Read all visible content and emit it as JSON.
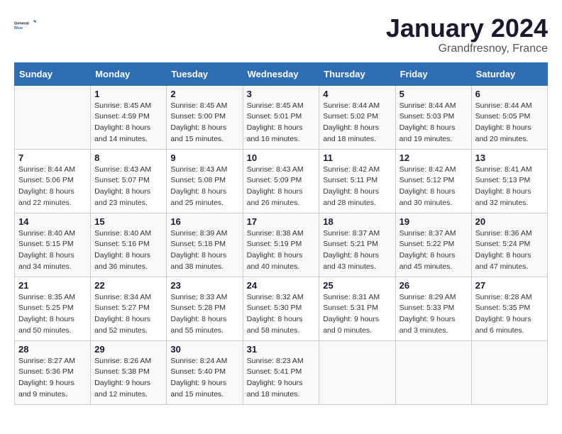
{
  "logo": {
    "line1": "General",
    "line2": "Blue"
  },
  "title": "January 2024",
  "subtitle": "Grandfresnoy, France",
  "days_of_week": [
    "Sunday",
    "Monday",
    "Tuesday",
    "Wednesday",
    "Thursday",
    "Friday",
    "Saturday"
  ],
  "weeks": [
    [
      {
        "day": "",
        "sunrise": "",
        "sunset": "",
        "daylight": ""
      },
      {
        "day": "1",
        "sunrise": "Sunrise: 8:45 AM",
        "sunset": "Sunset: 4:59 PM",
        "daylight": "Daylight: 8 hours and 14 minutes."
      },
      {
        "day": "2",
        "sunrise": "Sunrise: 8:45 AM",
        "sunset": "Sunset: 5:00 PM",
        "daylight": "Daylight: 8 hours and 15 minutes."
      },
      {
        "day": "3",
        "sunrise": "Sunrise: 8:45 AM",
        "sunset": "Sunset: 5:01 PM",
        "daylight": "Daylight: 8 hours and 16 minutes."
      },
      {
        "day": "4",
        "sunrise": "Sunrise: 8:44 AM",
        "sunset": "Sunset: 5:02 PM",
        "daylight": "Daylight: 8 hours and 18 minutes."
      },
      {
        "day": "5",
        "sunrise": "Sunrise: 8:44 AM",
        "sunset": "Sunset: 5:03 PM",
        "daylight": "Daylight: 8 hours and 19 minutes."
      },
      {
        "day": "6",
        "sunrise": "Sunrise: 8:44 AM",
        "sunset": "Sunset: 5:05 PM",
        "daylight": "Daylight: 8 hours and 20 minutes."
      }
    ],
    [
      {
        "day": "7",
        "sunrise": "Sunrise: 8:44 AM",
        "sunset": "Sunset: 5:06 PM",
        "daylight": "Daylight: 8 hours and 22 minutes."
      },
      {
        "day": "8",
        "sunrise": "Sunrise: 8:43 AM",
        "sunset": "Sunset: 5:07 PM",
        "daylight": "Daylight: 8 hours and 23 minutes."
      },
      {
        "day": "9",
        "sunrise": "Sunrise: 8:43 AM",
        "sunset": "Sunset: 5:08 PM",
        "daylight": "Daylight: 8 hours and 25 minutes."
      },
      {
        "day": "10",
        "sunrise": "Sunrise: 8:43 AM",
        "sunset": "Sunset: 5:09 PM",
        "daylight": "Daylight: 8 hours and 26 minutes."
      },
      {
        "day": "11",
        "sunrise": "Sunrise: 8:42 AM",
        "sunset": "Sunset: 5:11 PM",
        "daylight": "Daylight: 8 hours and 28 minutes."
      },
      {
        "day": "12",
        "sunrise": "Sunrise: 8:42 AM",
        "sunset": "Sunset: 5:12 PM",
        "daylight": "Daylight: 8 hours and 30 minutes."
      },
      {
        "day": "13",
        "sunrise": "Sunrise: 8:41 AM",
        "sunset": "Sunset: 5:13 PM",
        "daylight": "Daylight: 8 hours and 32 minutes."
      }
    ],
    [
      {
        "day": "14",
        "sunrise": "Sunrise: 8:40 AM",
        "sunset": "Sunset: 5:15 PM",
        "daylight": "Daylight: 8 hours and 34 minutes."
      },
      {
        "day": "15",
        "sunrise": "Sunrise: 8:40 AM",
        "sunset": "Sunset: 5:16 PM",
        "daylight": "Daylight: 8 hours and 36 minutes."
      },
      {
        "day": "16",
        "sunrise": "Sunrise: 8:39 AM",
        "sunset": "Sunset: 5:18 PM",
        "daylight": "Daylight: 8 hours and 38 minutes."
      },
      {
        "day": "17",
        "sunrise": "Sunrise: 8:38 AM",
        "sunset": "Sunset: 5:19 PM",
        "daylight": "Daylight: 8 hours and 40 minutes."
      },
      {
        "day": "18",
        "sunrise": "Sunrise: 8:37 AM",
        "sunset": "Sunset: 5:21 PM",
        "daylight": "Daylight: 8 hours and 43 minutes."
      },
      {
        "day": "19",
        "sunrise": "Sunrise: 8:37 AM",
        "sunset": "Sunset: 5:22 PM",
        "daylight": "Daylight: 8 hours and 45 minutes."
      },
      {
        "day": "20",
        "sunrise": "Sunrise: 8:36 AM",
        "sunset": "Sunset: 5:24 PM",
        "daylight": "Daylight: 8 hours and 47 minutes."
      }
    ],
    [
      {
        "day": "21",
        "sunrise": "Sunrise: 8:35 AM",
        "sunset": "Sunset: 5:25 PM",
        "daylight": "Daylight: 8 hours and 50 minutes."
      },
      {
        "day": "22",
        "sunrise": "Sunrise: 8:34 AM",
        "sunset": "Sunset: 5:27 PM",
        "daylight": "Daylight: 8 hours and 52 minutes."
      },
      {
        "day": "23",
        "sunrise": "Sunrise: 8:33 AM",
        "sunset": "Sunset: 5:28 PM",
        "daylight": "Daylight: 8 hours and 55 minutes."
      },
      {
        "day": "24",
        "sunrise": "Sunrise: 8:32 AM",
        "sunset": "Sunset: 5:30 PM",
        "daylight": "Daylight: 8 hours and 58 minutes."
      },
      {
        "day": "25",
        "sunrise": "Sunrise: 8:31 AM",
        "sunset": "Sunset: 5:31 PM",
        "daylight": "Daylight: 9 hours and 0 minutes."
      },
      {
        "day": "26",
        "sunrise": "Sunrise: 8:29 AM",
        "sunset": "Sunset: 5:33 PM",
        "daylight": "Daylight: 9 hours and 3 minutes."
      },
      {
        "day": "27",
        "sunrise": "Sunrise: 8:28 AM",
        "sunset": "Sunset: 5:35 PM",
        "daylight": "Daylight: 9 hours and 6 minutes."
      }
    ],
    [
      {
        "day": "28",
        "sunrise": "Sunrise: 8:27 AM",
        "sunset": "Sunset: 5:36 PM",
        "daylight": "Daylight: 9 hours and 9 minutes."
      },
      {
        "day": "29",
        "sunrise": "Sunrise: 8:26 AM",
        "sunset": "Sunset: 5:38 PM",
        "daylight": "Daylight: 9 hours and 12 minutes."
      },
      {
        "day": "30",
        "sunrise": "Sunrise: 8:24 AM",
        "sunset": "Sunset: 5:40 PM",
        "daylight": "Daylight: 9 hours and 15 minutes."
      },
      {
        "day": "31",
        "sunrise": "Sunrise: 8:23 AM",
        "sunset": "Sunset: 5:41 PM",
        "daylight": "Daylight: 9 hours and 18 minutes."
      },
      {
        "day": "",
        "sunrise": "",
        "sunset": "",
        "daylight": ""
      },
      {
        "day": "",
        "sunrise": "",
        "sunset": "",
        "daylight": ""
      },
      {
        "day": "",
        "sunrise": "",
        "sunset": "",
        "daylight": ""
      }
    ]
  ]
}
